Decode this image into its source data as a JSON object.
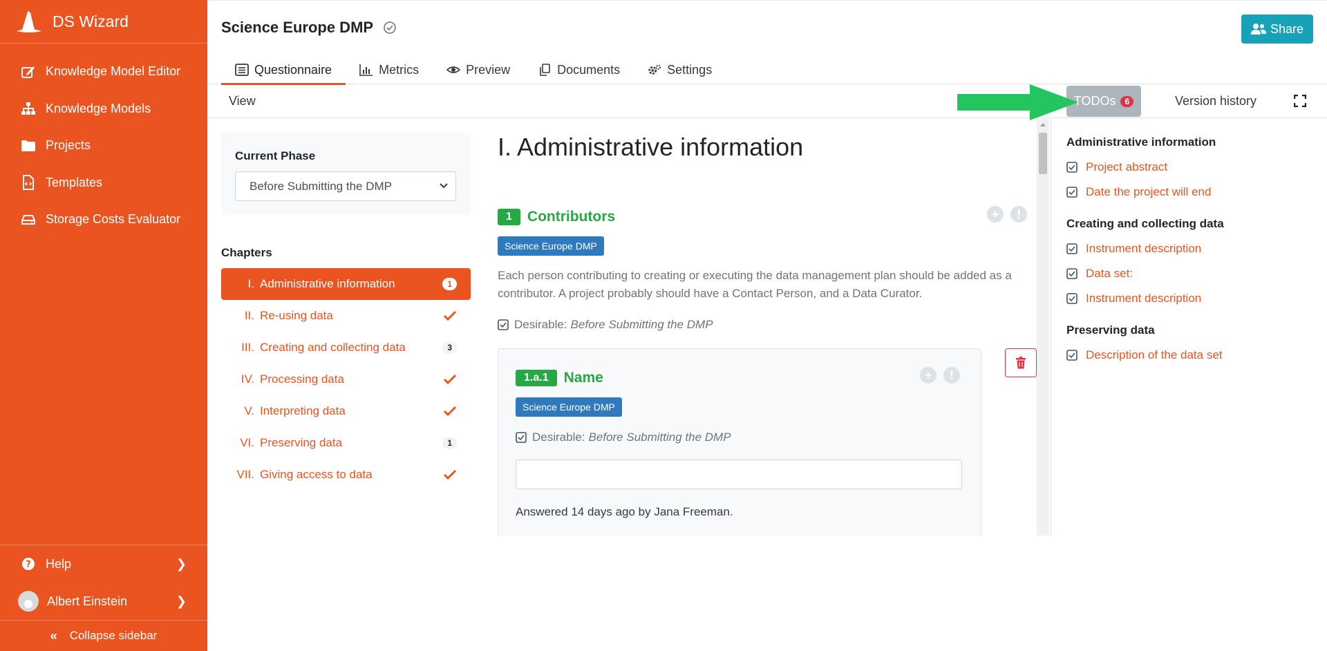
{
  "app": {
    "name": "DS Wizard"
  },
  "sidebar": {
    "items": [
      {
        "label": "Knowledge Model Editor",
        "icon": "edit-icon"
      },
      {
        "label": "Knowledge Models",
        "icon": "sitemap-icon"
      },
      {
        "label": "Projects",
        "icon": "folder-icon"
      },
      {
        "label": "Templates",
        "icon": "file-code-icon"
      },
      {
        "label": "Storage Costs Evaluator",
        "icon": "hdd-icon"
      }
    ],
    "help_label": "Help",
    "user_name": "Albert Einstein",
    "collapse_label": "Collapse sidebar"
  },
  "header": {
    "title": "Science Europe DMP",
    "share_label": "Share",
    "tabs": [
      {
        "label": "Questionnaire",
        "icon": "list-icon"
      },
      {
        "label": "Metrics",
        "icon": "chart-icon"
      },
      {
        "label": "Preview",
        "icon": "eye-icon"
      },
      {
        "label": "Documents",
        "icon": "copy-icon"
      },
      {
        "label": "Settings",
        "icon": "cogs-icon"
      }
    ]
  },
  "viewbar": {
    "view_label": "View",
    "todos_label": "TODOs",
    "todos_count": "6",
    "version_history_label": "Version history"
  },
  "phase": {
    "label": "Current Phase",
    "selected": "Before Submitting the DMP"
  },
  "chapters": {
    "label": "Chapters",
    "items": [
      {
        "num": "I.",
        "name": "Administrative information",
        "badge": "1",
        "active": true
      },
      {
        "num": "II.",
        "name": "Re-using data",
        "complete": true
      },
      {
        "num": "III.",
        "name": "Creating and collecting data",
        "badge": "3"
      },
      {
        "num": "IV.",
        "name": "Processing data",
        "complete": true
      },
      {
        "num": "V.",
        "name": "Interpreting data",
        "complete": true
      },
      {
        "num": "VI.",
        "name": "Preserving data",
        "badge": "1"
      },
      {
        "num": "VII.",
        "name": "Giving access to data",
        "complete": true
      }
    ]
  },
  "content": {
    "chapter_title": "I. Administrative information",
    "question": {
      "num": "1",
      "title": "Contributors",
      "tag": "Science Europe DMP",
      "description": "Each person contributing to creating or executing the data management plan should be added as a contributor. A project probably should have a Contact Person, and a Data Curator.",
      "desirable_label": "Desirable:",
      "desirable_phase": "Before Submitting the DMP"
    },
    "item": {
      "num": "1.a.1",
      "title": "Name",
      "tag": "Science Europe DMP",
      "desirable_label": "Desirable:",
      "desirable_phase": "Before Submitting the DMP",
      "answer_value": "",
      "answered_text": "Answered 14 days ago by Jana Freeman."
    }
  },
  "todos": {
    "groups": [
      {
        "title": "Administrative information",
        "items": [
          "Project abstract",
          "Date the project will end"
        ]
      },
      {
        "title": "Creating and collecting data",
        "items": [
          "Instrument description",
          "Data set:",
          "Instrument description"
        ]
      },
      {
        "title": "Preserving data",
        "items": [
          "Description of the data set"
        ]
      }
    ]
  },
  "colors": {
    "brand": "#e95420",
    "success": "#28a745",
    "info": "#17a2b8",
    "tag": "#2f7abf",
    "danger": "#dc3545",
    "arrow": "#22c55e"
  }
}
